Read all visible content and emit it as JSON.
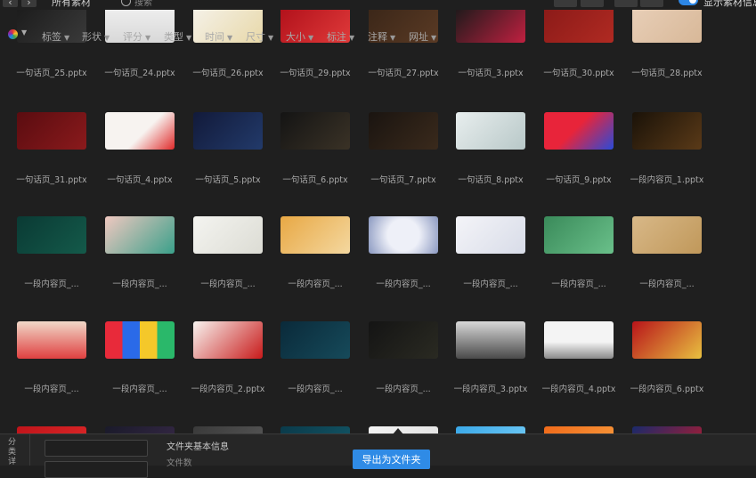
{
  "topbar": {
    "back_icon": "chevron-left-icon",
    "forward_icon": "chevron-right-icon",
    "title": "所有素材",
    "search_placeholder": "搜索",
    "show_info_label": "显示素材信息",
    "accent": "#2d87e6"
  },
  "filters": [
    {
      "label": "标签"
    },
    {
      "label": "形状"
    },
    {
      "label": "评分"
    },
    {
      "label": "类型"
    },
    {
      "label": "时间"
    },
    {
      "label": "尺寸"
    },
    {
      "label": "大小"
    },
    {
      "label": "标注"
    },
    {
      "label": "注释"
    },
    {
      "label": "网址"
    }
  ],
  "rows": [
    {
      "items": [
        {
          "name": "一句话页_25.pptx",
          "bg": "linear-gradient(135deg,#1b1b1b,#3a3a3a)"
        },
        {
          "name": "一句话页_24.pptx",
          "bg": "linear-gradient(180deg,#f0f0f0,#d8d8d8)"
        },
        {
          "name": "一句话页_26.pptx",
          "bg": "linear-gradient(135deg,#f5f2ea,#e8d8a8)"
        },
        {
          "name": "一句话页_29.pptx",
          "bg": "linear-gradient(135deg,#b0101a,#e03a3a)"
        },
        {
          "name": "一句话页_27.pptx",
          "bg": "linear-gradient(135deg,#3a2618,#5a3a24)"
        },
        {
          "name": "一句话页_3.pptx",
          "bg": "linear-gradient(135deg,#1a1a1a,#c02040)"
        },
        {
          "name": "一句话页_30.pptx",
          "bg": "linear-gradient(135deg,#8a1a18,#b02a22)"
        },
        {
          "name": "一句话页_28.pptx",
          "bg": "linear-gradient(135deg,#e8cfb8,#d8b898)"
        }
      ]
    },
    {
      "items": [
        {
          "name": "一句话页_31.pptx",
          "bg": "linear-gradient(135deg,#5a0c10,#8a1a1c)"
        },
        {
          "name": "一句话页_4.pptx",
          "bg": "linear-gradient(135deg,#f7f3f0 55%,#e02a2a)"
        },
        {
          "name": "一句话页_5.pptx",
          "bg": "linear-gradient(135deg,#121a3a,#223a6a)"
        },
        {
          "name": "一句话页_6.pptx",
          "bg": "linear-gradient(135deg,#141414,#3a3226)"
        },
        {
          "name": "一句话页_7.pptx",
          "bg": "linear-gradient(135deg,#1a1410,#3a2a1c)"
        },
        {
          "name": "一句话页_8.pptx",
          "bg": "linear-gradient(135deg,#e8eeee,#b8c8c8)"
        },
        {
          "name": "一句话页_9.pptx",
          "bg": "linear-gradient(135deg,#e8243a 45%,#2a4ad8)"
        },
        {
          "name": "一段内容页_1.pptx",
          "bg": "linear-gradient(135deg,#1a1208,#5a3a18)"
        }
      ]
    },
    {
      "items": [
        {
          "name": "一段内容页_...",
          "bg": "linear-gradient(135deg,#0a3a34,#145a4a)"
        },
        {
          "name": "一段内容页_...",
          "bg": "linear-gradient(135deg,#f0c8c0,#3aa08a)"
        },
        {
          "name": "一段内容页_...",
          "bg": "linear-gradient(135deg,#f4f4f0,#dcdcd4)"
        },
        {
          "name": "一段内容页_...",
          "bg": "linear-gradient(135deg,#e8a844,#f4d8a0)"
        },
        {
          "name": "一段内容页_...",
          "bg": "radial-gradient(circle,#eef0f8 40%,#8a98c0)"
        },
        {
          "name": "一段内容页_...",
          "bg": "linear-gradient(135deg,#f4f4f8,#d8dce8)"
        },
        {
          "name": "一段内容页_...",
          "bg": "linear-gradient(135deg,#3a8a5a,#6ac08a)"
        },
        {
          "name": "一段内容页_...",
          "bg": "linear-gradient(135deg,#d8b888,#c0985a)"
        }
      ]
    },
    {
      "items": [
        {
          "name": "一段内容页_...",
          "bg": "linear-gradient(180deg,#f0d8c8,#e04040)"
        },
        {
          "name": "一段内容页_...",
          "bg": "linear-gradient(90deg,#e82a3a 25%,#2a6ae8 25%,#2a6ae8 50%,#f4c82a 50%,#f4c82a 75%,#2ab86a 75%)"
        },
        {
          "name": "一段内容页_2.pptx",
          "bg": "linear-gradient(135deg,#f8f4f0,#c81a1a)"
        },
        {
          "name": "一段内容页_...",
          "bg": "linear-gradient(135deg,#0a2a3a,#164a5a)"
        },
        {
          "name": "一段内容页_...",
          "bg": "linear-gradient(135deg,#141414,#2a2a22)"
        },
        {
          "name": "一段内容页_3.pptx",
          "bg": "linear-gradient(180deg,#d8d8d8,#4a4a4a)"
        },
        {
          "name": "一段内容页_4.pptx",
          "bg": "linear-gradient(180deg,#f4f4f4 55%,#8a8a8a)"
        },
        {
          "name": "一段内容页_6.pptx",
          "bg": "linear-gradient(135deg,#b8141a,#e8c040)"
        }
      ]
    },
    {
      "items": [
        {
          "name": "",
          "bg": "linear-gradient(135deg,#c0141a,#e02a2a)"
        },
        {
          "name": "",
          "bg": "linear-gradient(135deg,#1a1a2a,#3a2a4a)"
        },
        {
          "name": "",
          "bg": "linear-gradient(135deg,#3a3a3a,#5a5a5a)"
        },
        {
          "name": "",
          "bg": "linear-gradient(135deg,#0a3a4a,#145a6a)"
        },
        {
          "name": "",
          "bg": "linear-gradient(135deg,#f4f4f4,#dddddd)"
        },
        {
          "name": "",
          "bg": "linear-gradient(135deg,#3aa8e8,#7ad0f8)"
        },
        {
          "name": "",
          "bg": "linear-gradient(135deg,#f06a1a,#f8a040)"
        },
        {
          "name": "",
          "bg": "linear-gradient(135deg,#1a2a6a,#c01a2a)"
        }
      ]
    }
  ],
  "bottombar": {
    "side_label": "分类详",
    "folder_info_title": "文件夹基本信息",
    "file_count_label": "文件数",
    "export_label": "导出为文件夹"
  }
}
